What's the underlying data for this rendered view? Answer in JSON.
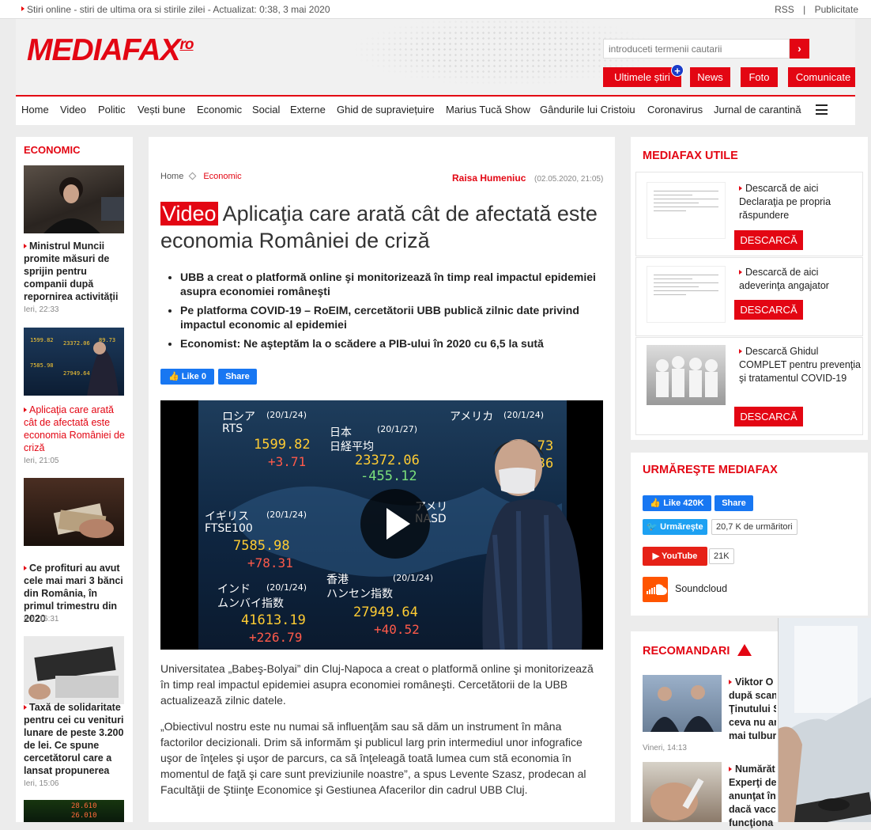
{
  "topbar": {
    "tagline": "Stiri online - stiri de ultima ora si stirile zilei - Actualizat: 0:38, 3 mai 2020",
    "rss": "RSS",
    "sep": "|",
    "ads": "Publicitate"
  },
  "header": {
    "logo": "MEDIAFAX",
    "logo_suffix": "ro",
    "search_placeholder": "introduceti termenii cautarii",
    "buttons": [
      "Ultimele știri",
      "News",
      "Foto",
      "Comunicate"
    ],
    "plus": "+"
  },
  "nav": [
    "Home",
    "Video",
    "Politic",
    "Vești bune",
    "Economic",
    "Social",
    "Externe",
    "Ghid de supraviețuire",
    "Marius Tucă Show",
    "Gândurile lui Cristoiu",
    "Coronavirus",
    "Jurnal de carantină"
  ],
  "left": {
    "section": "ECONOMIC",
    "items": [
      {
        "title": "Ministrul Muncii promite măsuri de sprijin pentru companii după repornirea activității",
        "time": "Ieri, 22:33"
      },
      {
        "title": "Aplicaţia care arată cât de afectată este economia României de criză",
        "time": "Ieri, 21:05"
      },
      {
        "title": "Ce profituri au avut cele mai mari 3 bănci din România, în primul trimestru din 2020",
        "time": "Ieri, 16:31"
      },
      {
        "title": "Taxă de solidaritate pentru cei cu venituri lunare de peste 3.200 de lei. Ce spune cercetătorul care a lansat propunerea",
        "time": "Ieri, 15:06"
      }
    ]
  },
  "article": {
    "crumb_home": "Home",
    "crumb_cat": "Economic",
    "author": "Raisa Humeniuc",
    "date": "(02.05.2020, 21:05)",
    "badge": "Video",
    "title": "Aplicaţia care arată cât de afectată este economia României de criză",
    "bullets": [
      "UBB a creat o platformă online şi monitorizează în timp real impactul epidemiei asupra economiei româneşti",
      "Pe platforma COVID-19 – RoEIM, cercetătorii UBB publică zilnic date privind impactul economic al epidemiei",
      "Economist: Ne aşteptăm la o scădere a PIB-ului în 2020 cu 6,5 la sută"
    ],
    "fb_like": "Like 0",
    "fb_share": "Share",
    "video": {
      "labels": [
        "ロシア",
        "RTS",
        "(20/1/24)",
        "1599.82",
        "+3.71",
        "日本",
        "日経平均",
        "(20/1/27)",
        "23372.06",
        "-455.12",
        "アメリカ",
        "(20/1/24)",
        "89.73",
        "70.36",
        "アメリ",
        "NASD",
        "イギリス",
        "FTSE100",
        "(20/1/24)",
        "7585.98",
        "+78.31",
        "インド",
        "ムンバイ指数",
        "(20/1/24)",
        "41613.19",
        "+226.79",
        "香港",
        "ハンセン指数",
        "(20/1/24)",
        "27949.64",
        "+40.52"
      ]
    },
    "paragraphs": [
      "Universitatea „Babeş-Bolyai” din Cluj-Napoca a creat o platformă online şi monitorizează în timp real impactul epidemiei asupra economiei româneşti. Cercetătorii de la UBB actualizează zilnic datele.",
      "„Obiectivul nostru este nu numai să influenţăm sau să dăm un instrument în mâna factorilor decizionali. Drim să informăm şi publicul larg prin intermediul unor infografice uşor de înţeles şi uşor de parcurs, ca să înţeleagă toată lumea cum stă economia în momentul de faţă şi care sunt previziunile noastre”, a spus Levente Szasz, prodecan al Facultăţii de Ştiinţe Economice şi Gestiunea Afacerilor din cadrul UBB Cluj."
    ]
  },
  "right": {
    "utile_title": "MEDIAFAX UTILE",
    "utile": [
      {
        "text": "Descarcă de aici Declaraţia pe propria răspundere",
        "btn": "DESCARCĂ"
      },
      {
        "text": "Descarcă de aici adeverinţa angajator",
        "btn": "DESCARCĂ"
      },
      {
        "text": "Descarcă Ghidul COMPLET pentru prevenţia şi tratamentul COVID-19",
        "btn": "DESCARCĂ"
      }
    ],
    "follow_title": "URMĂREŞTE MEDIAFAX",
    "fb_like": "Like 420K",
    "fb_share": "Share",
    "tw_btn": "Urmăreşte",
    "tw_count": "20,7 K de urmăritori",
    "yt_btn": "YouTube",
    "yt_count": "21K",
    "soundcloud": "Soundcloud",
    "rec_title": "RECOMANDARI",
    "rec": [
      {
        "lines": [
          "Viktor O",
          "după scanc",
          "Ţinutului S",
          "ceva nu am",
          "mai tulbur"
        ],
        "time": "Vineri, 14:13"
      },
      {
        "lines": [
          "Numărăt",
          "Experţi de",
          "anunţat în",
          "dacă vaccin",
          "funcţiona"
        ],
        "time": ""
      }
    ]
  },
  "colors": {
    "brand": "#e30613",
    "facebook": "#1877f2",
    "twitter": "#1da1f2",
    "youtube": "#e62117",
    "soundcloud": "#ff5500"
  }
}
